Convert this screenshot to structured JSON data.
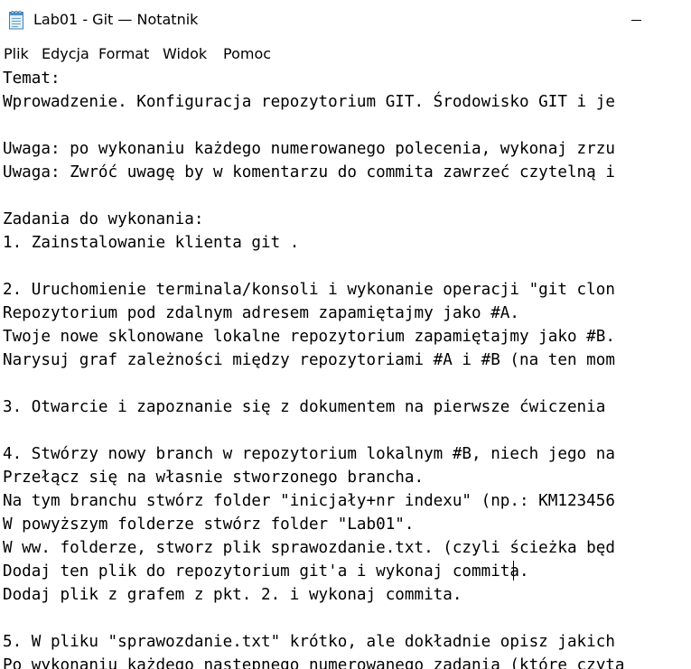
{
  "window": {
    "title": "Lab01 - Git — Notatnik"
  },
  "menu": [
    {
      "label": "Plik"
    },
    {
      "label": "Edycja"
    },
    {
      "label": "Format"
    },
    {
      "label": "Widok"
    },
    {
      "label": "Pomoc"
    }
  ],
  "editor": {
    "lines": [
      "Temat:",
      "Wprowadzenie. Konfiguracja repozytorium GIT. Środowisko GIT i je",
      "",
      "Uwaga: po wykonaniu każdego numerowanego polecenia, wykonaj zrzu",
      "Uwaga: Zwróć uwagę by w komentarzu do commita zawrzeć czytelną i",
      "",
      "Zadania do wykonania:",
      "1. Zainstalowanie klienta git .",
      "",
      "2. Uruchomienie terminala/konsoli i wykonanie operacji \"git clon",
      "Repozytorium pod zdalnym adresem zapamiętajmy jako #A.",
      "Twoje nowe sklonowane lokalne repozytorium zapamiętajmy jako #B.",
      "Narysuj graf zależności między repozytoriami #A i #B (na ten mom",
      "",
      "3. Otwarcie i zapoznanie się z dokumentem na pierwsze ćwiczenia",
      "",
      "4. Stwórzy nowy branch w repozytorium lokalnym #B, niech jego na",
      "Przełącz się na własnie stworzonego brancha.",
      "Na tym branchu stwórz folder \"inicjały+nr indexu\" (np.: KM123456",
      "W powyższym folderze stwórz folder \"Lab01\".",
      "W ww. folderze, stworz plik sprawozdanie.txt. (czyli ścieżka będ",
      "Dodaj ten plik do repozytorium git'a i wykonaj commita.",
      "Dodaj plik z grafem z pkt. 2. i wykonaj commita.",
      "",
      "5. W pliku \"sprawozdanie.txt\" krótko, ale dokładnie opisz jakich",
      "Po wykonaniu każdego następnego numerowanego zadania (które czyta"
    ]
  }
}
